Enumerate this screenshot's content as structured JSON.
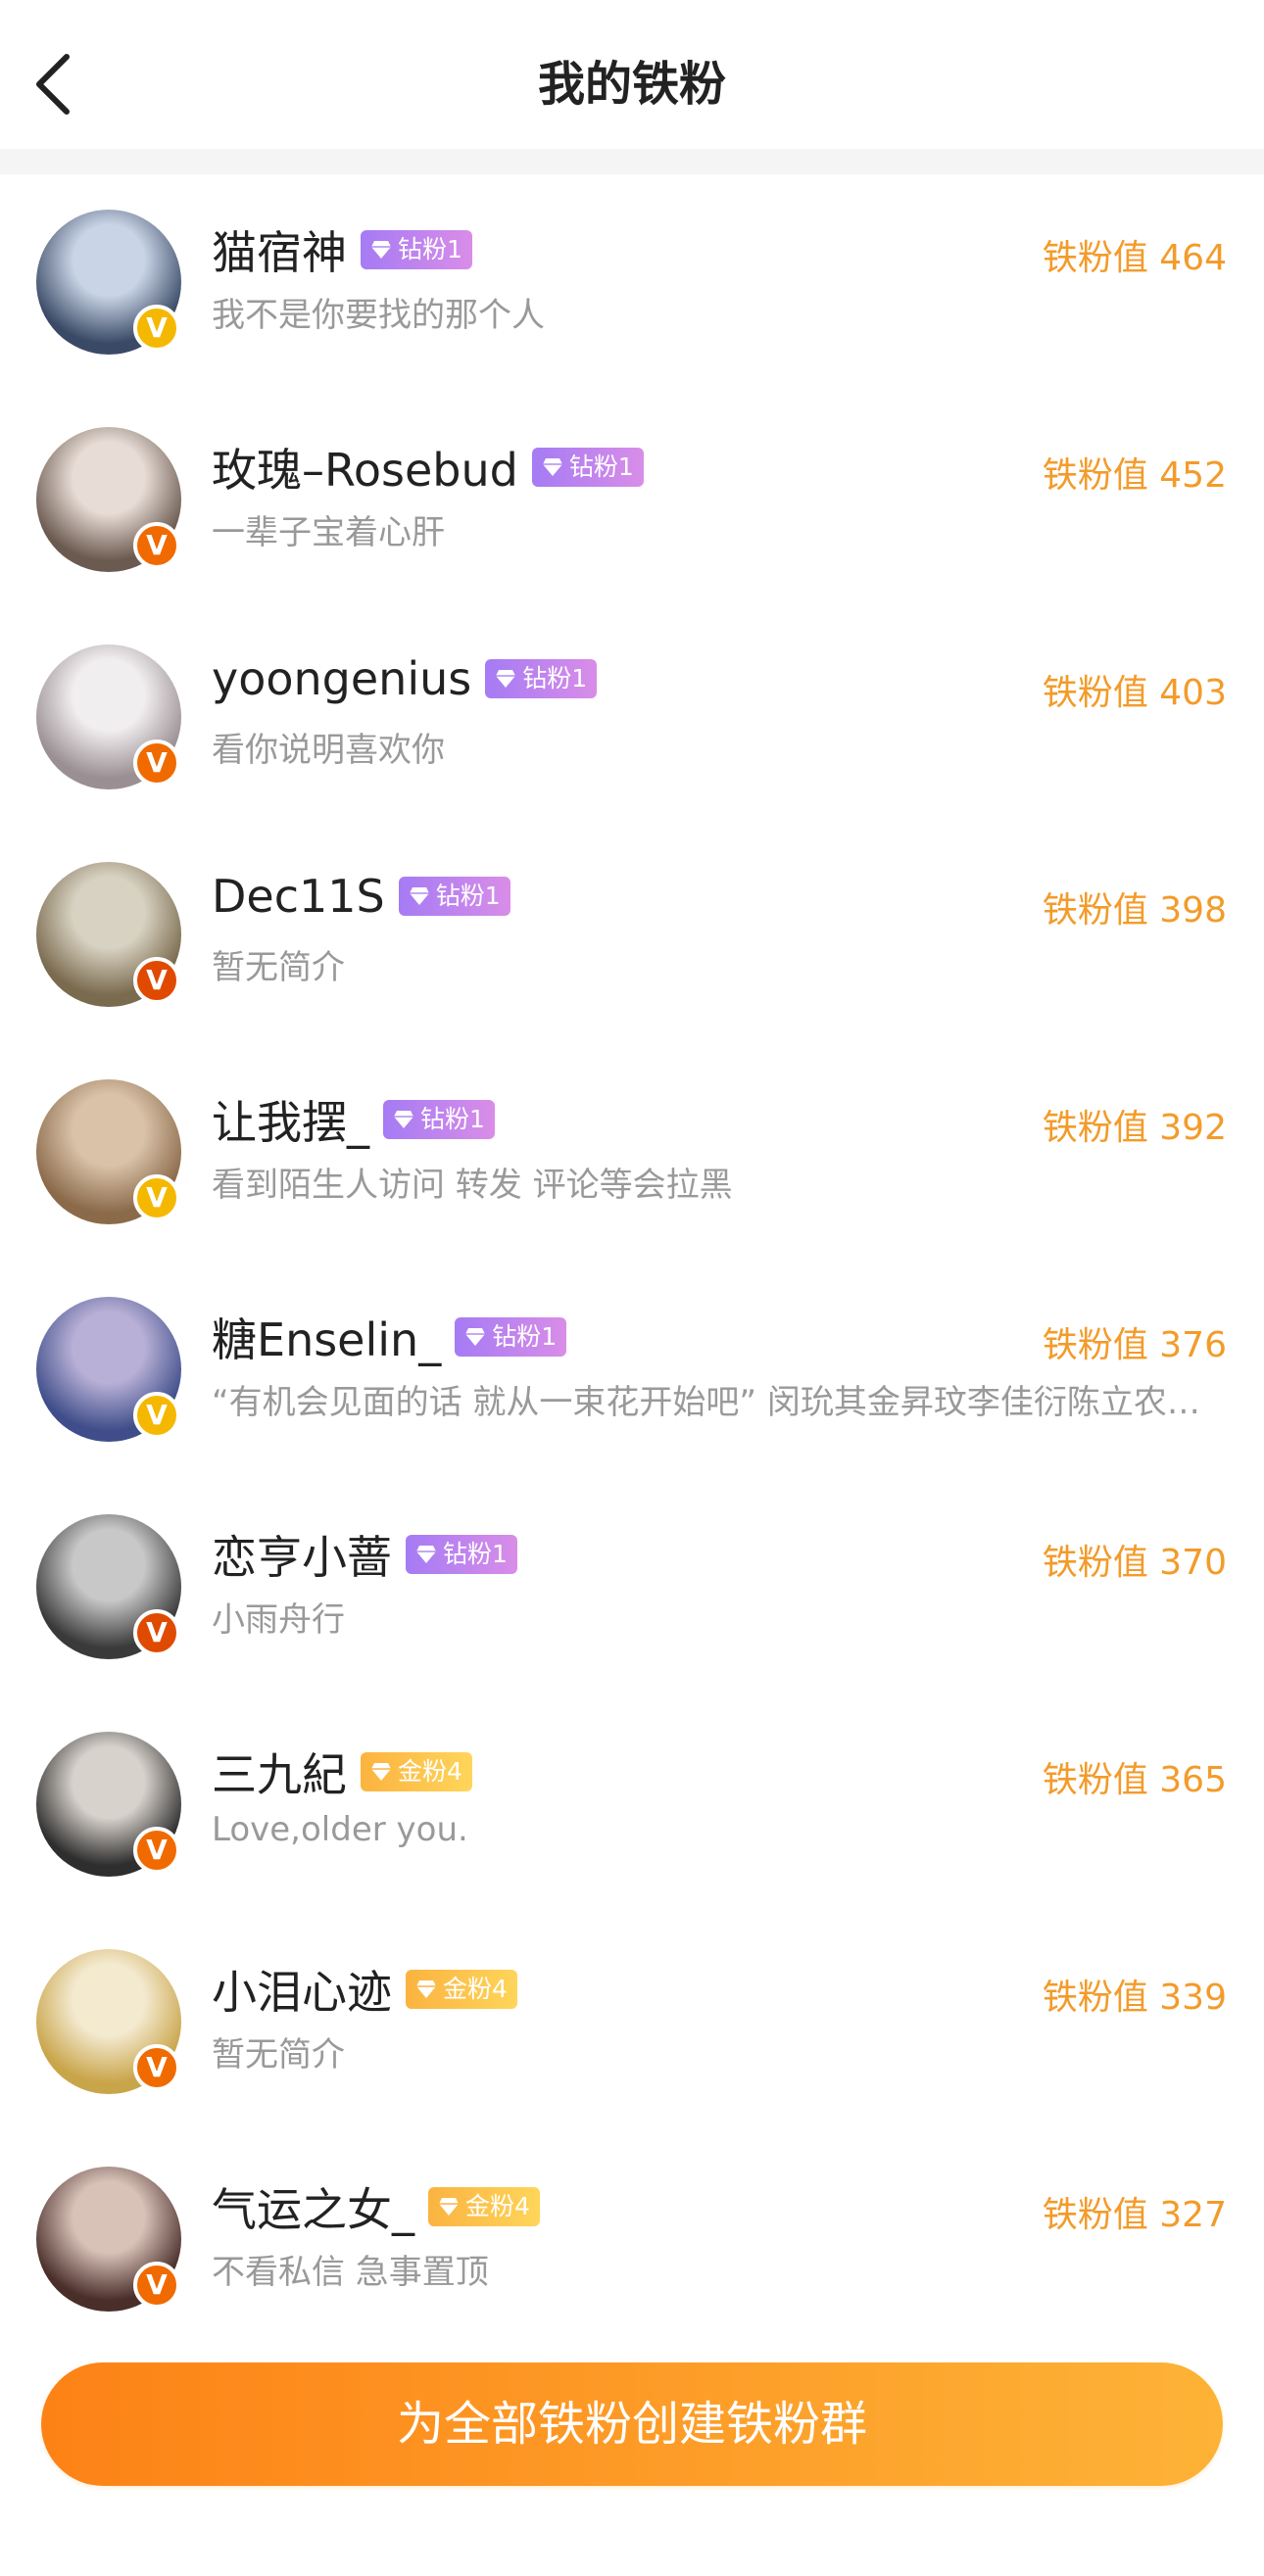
{
  "header": {
    "title": "我的铁粉"
  },
  "value_prefix": "铁粉值",
  "fans": [
    {
      "name": "猫宿神",
      "badge": "钻粉1",
      "badge_type": "diamond",
      "value": "464",
      "bio": "我不是你要找的那个人",
      "v_color": "#f5b800",
      "avatar_colors": [
        "#3a4a66",
        "#c9d4e6"
      ]
    },
    {
      "name": "玫瑰–Rosebud",
      "badge": "钻粉1",
      "badge_type": "diamond",
      "value": "452",
      "bio": "一辈子宝着心肝",
      "v_color": "#f06a00",
      "avatar_colors": [
        "#6b5a50",
        "#e8ddd6"
      ]
    },
    {
      "name": "yoongenius",
      "badge": "钻粉1",
      "badge_type": "diamond",
      "value": "403",
      "bio": "看你说明喜欢你",
      "v_color": "#f06a00",
      "avatar_colors": [
        "#9a8f92",
        "#f1eef0"
      ]
    },
    {
      "name": "Dec11S",
      "badge": "钻粉1",
      "badge_type": "diamond",
      "value": "398",
      "bio": "暂无简介",
      "v_color": "#e04a00",
      "avatar_colors": [
        "#7a6a4e",
        "#d8d2c2"
      ]
    },
    {
      "name": "让我摆_",
      "badge": "钻粉1",
      "badge_type": "diamond",
      "value": "392",
      "bio": "看到陌生人访问 转发 评论等会拉黑",
      "v_color": "#f5b800",
      "avatar_colors": [
        "#8b6a4a",
        "#d9c2a8"
      ]
    },
    {
      "name": "糖Enselin_",
      "badge": "钻粉1",
      "badge_type": "diamond",
      "value": "376",
      "bio": "“有机会见面的话 就从一束花开始吧” 闵玧其金昇玟李佳衍陈立农钱锟",
      "v_color": "#f5b800",
      "avatar_colors": [
        "#3f4e8a",
        "#b8b0d6"
      ]
    },
    {
      "name": "恋亨小蔷",
      "badge": "钻粉1",
      "badge_type": "diamond",
      "value": "370",
      "bio": "小雨舟行",
      "v_color": "#e04a00",
      "avatar_colors": [
        "#3a3a3a",
        "#c8c8c8"
      ]
    },
    {
      "name": "三九紀",
      "badge": "金粉4",
      "badge_type": "gold",
      "value": "365",
      "bio": "Love,older you.",
      "v_color": "#f06a00",
      "avatar_colors": [
        "#2e2e2e",
        "#d8d2cc"
      ]
    },
    {
      "name": "小泪心迹",
      "badge": "金粉4",
      "badge_type": "gold",
      "value": "339",
      "bio": "暂无简介",
      "v_color": "#f06a00",
      "avatar_colors": [
        "#c9a54a",
        "#f4ead0"
      ]
    },
    {
      "name": "气运之女_",
      "badge": "金粉4",
      "badge_type": "gold",
      "value": "327",
      "bio": "不看私信 急事置顶",
      "v_color": "#f06a00",
      "avatar_colors": [
        "#4a2e2a",
        "#d8c2b8"
      ]
    }
  ],
  "cta": {
    "label": "为全部铁粉创建铁粉群"
  }
}
